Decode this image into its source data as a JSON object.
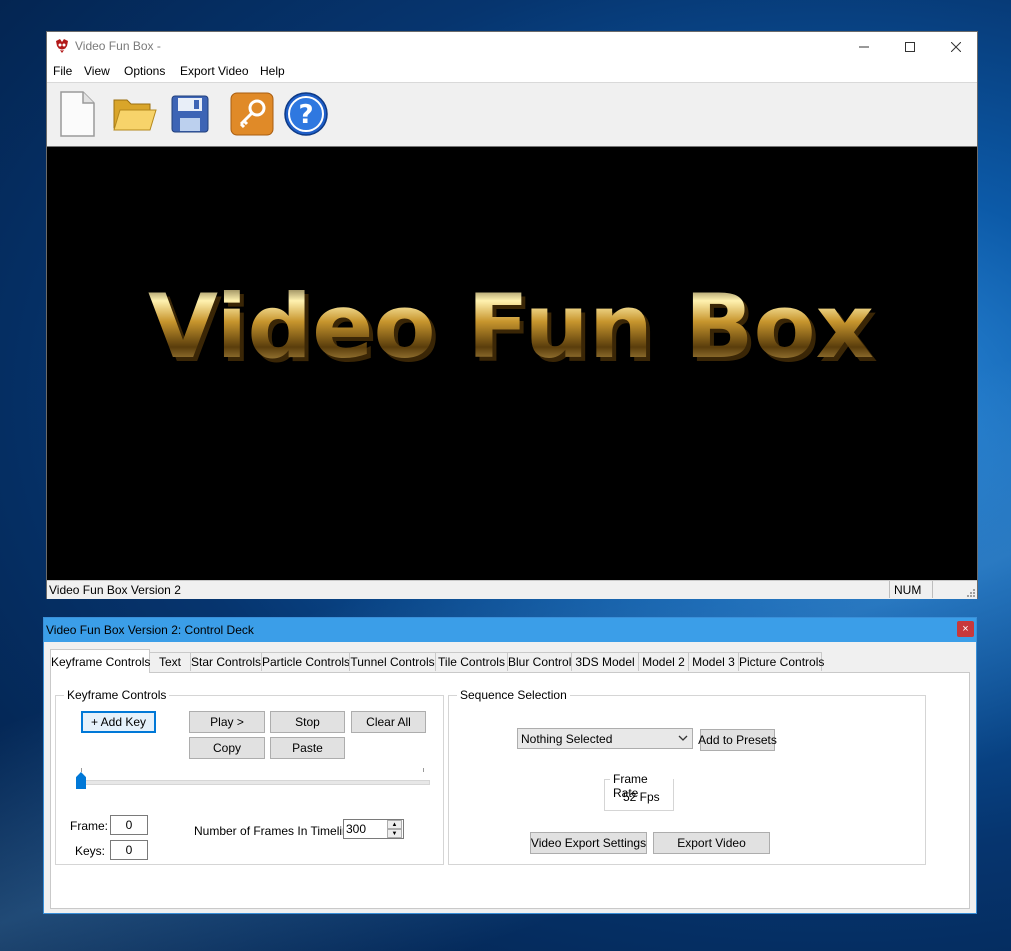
{
  "main_window": {
    "title": "Video Fun Box -",
    "menu": [
      "File",
      "View",
      "Options",
      "Export Video",
      "Help"
    ],
    "toolbar_icons": [
      "new-file-icon",
      "open-folder-icon",
      "save-disk-icon",
      "key-icon",
      "help-icon"
    ],
    "viewport_text": "Video Fun Box",
    "status_text": "Video Fun Box Version 2",
    "status_num": "NUM"
  },
  "control_deck": {
    "title": "Video Fun Box Version 2: Control Deck",
    "close_glyph": "×",
    "tabs": [
      "Keyframe Controls",
      "Text",
      "Star Controls",
      "Particle Controls",
      "Tunnel Controls",
      "Tile Controls",
      "Blur Control",
      "3DS Model",
      "Model 2",
      "Model 3",
      "Picture Controls"
    ],
    "keyframe_group": {
      "label": "Keyframe Controls",
      "add_key": "+ Add Key",
      "play": "Play >",
      "stop": "Stop",
      "clear_all": "Clear All",
      "copy": "Copy",
      "paste": "Paste",
      "frame_label": "Frame:",
      "frame_value": "0",
      "keys_label": "Keys:",
      "keys_value": "0",
      "frames_label": "Number of Frames In Timeline:",
      "frames_value": "300",
      "timeline_position": 0
    },
    "sequence_group": {
      "label": "Sequence Selection",
      "dropdown_value": "Nothing Selected",
      "add_presets": "Add to Presets",
      "frame_rate_label": "Frame Rate",
      "frame_rate_value": "52 Fps",
      "export_settings": "Video Export Settings",
      "export_video": "Export Video"
    }
  }
}
